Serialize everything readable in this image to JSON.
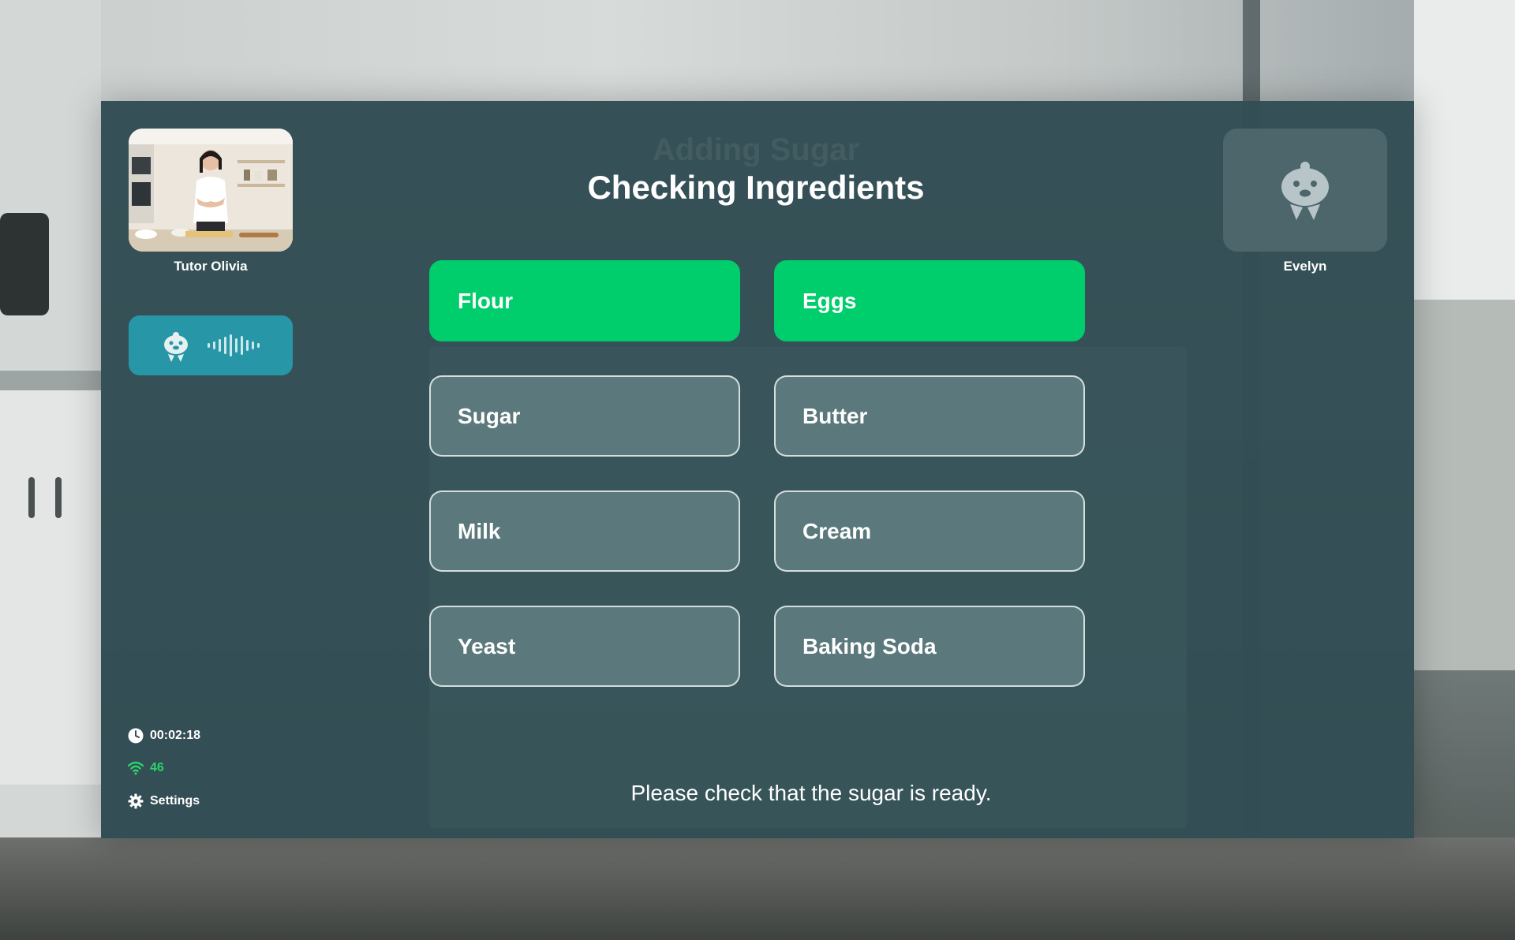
{
  "title": "Checking Ingredients",
  "previous_title": "Adding Sugar",
  "tutor": {
    "name": "Tutor Olivia"
  },
  "student": {
    "name": "Evelyn"
  },
  "options": [
    {
      "label": "Flour",
      "selected": true
    },
    {
      "label": "Eggs",
      "selected": true
    },
    {
      "label": "Sugar",
      "selected": false
    },
    {
      "label": "Butter",
      "selected": false
    },
    {
      "label": "Milk",
      "selected": false
    },
    {
      "label": "Cream",
      "selected": false
    },
    {
      "label": "Yeast",
      "selected": false
    },
    {
      "label": "Baking Soda",
      "selected": false
    }
  ],
  "prompt": "Please check that the sugar is ready.",
  "status": {
    "timer": "00:02:18",
    "signal": "46",
    "settings_label": "Settings"
  },
  "colors": {
    "panel": "#324d54",
    "selected": "#00cd6b",
    "voice_pill": "#2797a8",
    "signal": "#2bd36c"
  },
  "icons": {
    "timer": "clock-icon",
    "signal": "wifi-icon",
    "settings": "gear-icon",
    "mascot": "beaver-mascot-icon",
    "voice": "sound-wave-icon"
  }
}
